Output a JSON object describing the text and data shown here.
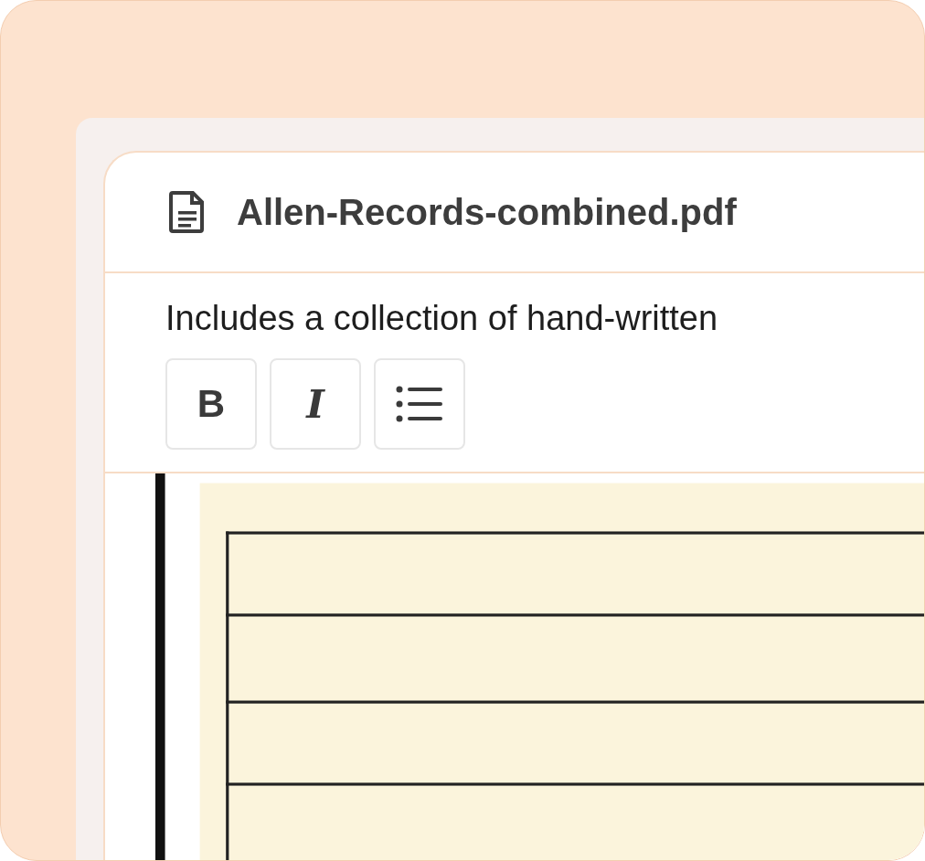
{
  "file": {
    "name": "Allen-Records-combined.pdf"
  },
  "description": "Includes a collection of hand-written",
  "toolbar": [
    {
      "kind": "bold",
      "label": "B"
    },
    {
      "kind": "italic",
      "label": "I"
    },
    {
      "kind": "bullet-list"
    }
  ]
}
